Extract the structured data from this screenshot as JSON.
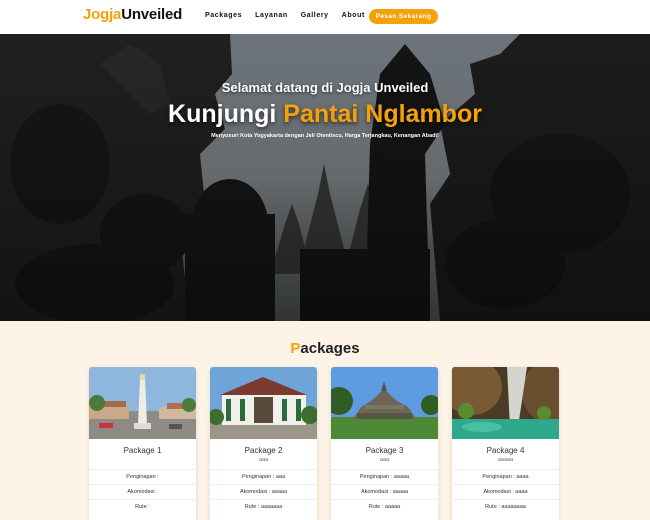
{
  "nav": {
    "brand_part1": "Jogja",
    "brand_part2": "Unveiled",
    "links": [
      "Packages",
      "Layanan",
      "Gallery",
      "About"
    ],
    "cta": "Pesan Sekarang",
    "accent": "#f5a20a"
  },
  "hero": {
    "welcome": "Selamat datang di Jogja Unveiled",
    "headline_prefix": "Kunjungi ",
    "headline_highlight": "Pantai Nglambor",
    "tagline": "Menyusuri Kota Yogyakarta dengan Jeli Otentiscu, Harga Terjangkau, Kenangan Abadi!"
  },
  "packages": {
    "title_first": "P",
    "title_rest": "ackages",
    "items": [
      {
        "name": "Package 1",
        "subtitle": "",
        "penginapan": "Penginapan :",
        "akomodasi": "Akomodasi :",
        "rute": "Rute :"
      },
      {
        "name": "Package 2",
        "subtitle": "aaa",
        "penginapan": "Penginapan : aaa",
        "akomodasi": "Akomodasi : aaaaa",
        "rute": "Rute : aaaaaaa"
      },
      {
        "name": "Package 3",
        "subtitle": "aaa",
        "penginapan": "Penginapan : aaaaa",
        "akomodasi": "Akomodasi : aaaaa",
        "rute": "Rute : aaaaa"
      },
      {
        "name": "Package 4",
        "subtitle": "aaaaa",
        "penginapan": "Penginapan : aaaa",
        "akomodasi": "Akomodasi : aaaa",
        "rute": "Rute : aaaaaaaa"
      }
    ]
  }
}
